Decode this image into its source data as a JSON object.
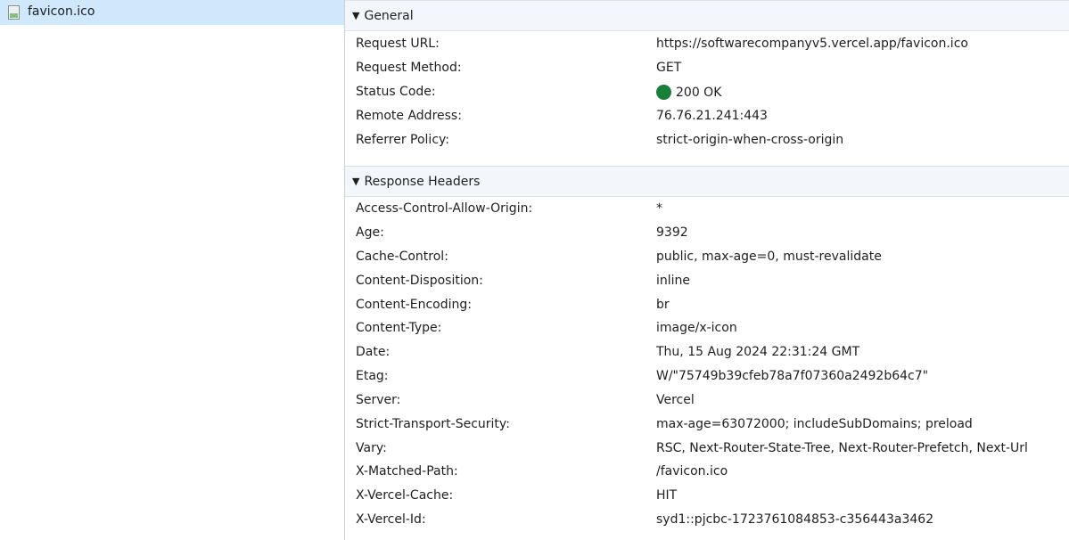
{
  "request_list": {
    "items": [
      {
        "name": "favicon.ico",
        "icon": "file-image-icon"
      }
    ]
  },
  "general": {
    "title": "General",
    "rows": [
      {
        "key": "Request URL:",
        "value": "https://softwarecompanyv5.vercel.app/favicon.ico"
      },
      {
        "key": "Request Method:",
        "value": "GET"
      },
      {
        "key": "Status Code:",
        "value": "200 OK",
        "status_color": "#188038"
      },
      {
        "key": "Remote Address:",
        "value": "76.76.21.241:443"
      },
      {
        "key": "Referrer Policy:",
        "value": "strict-origin-when-cross-origin"
      }
    ]
  },
  "response_headers": {
    "title": "Response Headers",
    "rows": [
      {
        "key": "Access-Control-Allow-Origin:",
        "value": "*"
      },
      {
        "key": "Age:",
        "value": "9392"
      },
      {
        "key": "Cache-Control:",
        "value": "public, max-age=0, must-revalidate"
      },
      {
        "key": "Content-Disposition:",
        "value": "inline"
      },
      {
        "key": "Content-Encoding:",
        "value": "br"
      },
      {
        "key": "Content-Type:",
        "value": "image/x-icon"
      },
      {
        "key": "Date:",
        "value": "Thu, 15 Aug 2024 22:31:24 GMT"
      },
      {
        "key": "Etag:",
        "value": "W/\"75749b39cfeb78a7f07360a2492b64c7\""
      },
      {
        "key": "Server:",
        "value": "Vercel"
      },
      {
        "key": "Strict-Transport-Security:",
        "value": "max-age=63072000; includeSubDomains; preload"
      },
      {
        "key": "Vary:",
        "value": "RSC, Next-Router-State-Tree, Next-Router-Prefetch, Next-Url"
      },
      {
        "key": "X-Matched-Path:",
        "value": "/favicon.ico"
      },
      {
        "key": "X-Vercel-Cache:",
        "value": "HIT"
      },
      {
        "key": "X-Vercel-Id:",
        "value": "syd1::pjcbc-1723761084853-c356443a3462"
      }
    ]
  }
}
